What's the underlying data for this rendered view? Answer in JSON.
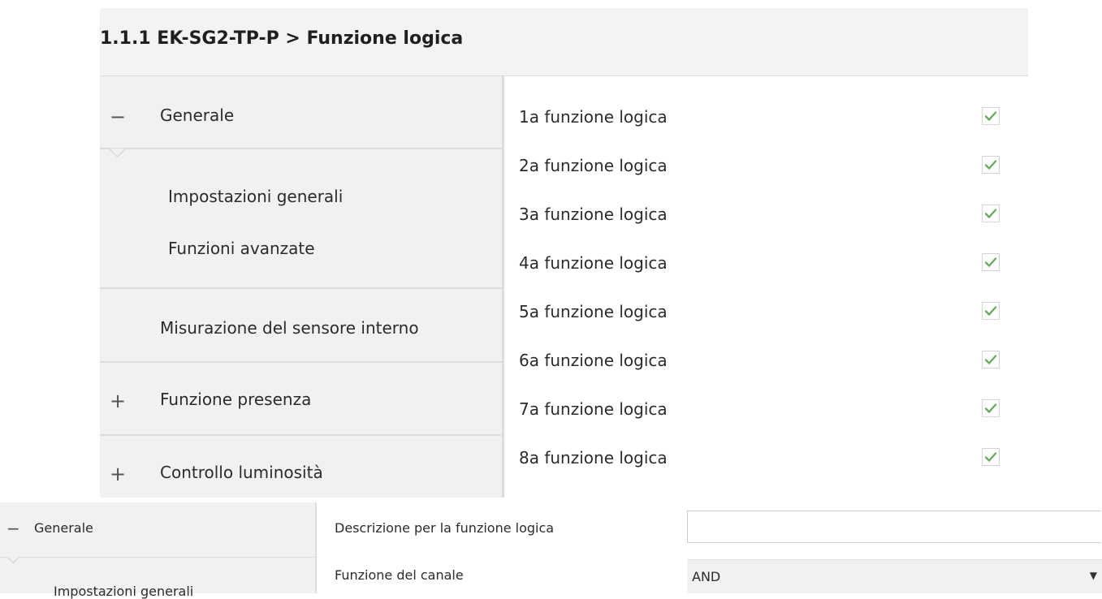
{
  "top": {
    "title": "1.1.1 EK-SG2-TP-P > Funzione logica",
    "sidebar": {
      "generale_glyph": "−",
      "generale_label": "Generale",
      "sub_items": [
        "Impostazioni generali",
        "Funzioni avanzate"
      ],
      "misurazione_label": "Misurazione del sensore interno",
      "presenza_glyph": "+",
      "presenza_label": "Funzione presenza",
      "luminosita_glyph": "+",
      "luminosita_label": "Controllo luminosità"
    },
    "logic_functions": [
      {
        "label": "1a funzione logica",
        "checked": true
      },
      {
        "label": "2a funzione logica",
        "checked": true
      },
      {
        "label": "3a funzione logica",
        "checked": true
      },
      {
        "label": "4a funzione logica",
        "checked": true
      },
      {
        "label": "5a funzione logica",
        "checked": true
      },
      {
        "label": "6a funzione logica",
        "checked": true
      },
      {
        "label": "7a funzione logica",
        "checked": true
      },
      {
        "label": "8a funzione logica",
        "checked": true
      }
    ],
    "check_color": "#6aaa64"
  },
  "bottom": {
    "sidebar": {
      "generale_glyph": "−",
      "generale_label": "Generale",
      "sub_item": "Impostazioni generali"
    },
    "description_label": "Descrizione per la funzione logica",
    "description_value": "",
    "channel_function_label": "Funzione del canale",
    "channel_function_value": "AND",
    "dropdown_icon": "triangle-down"
  }
}
